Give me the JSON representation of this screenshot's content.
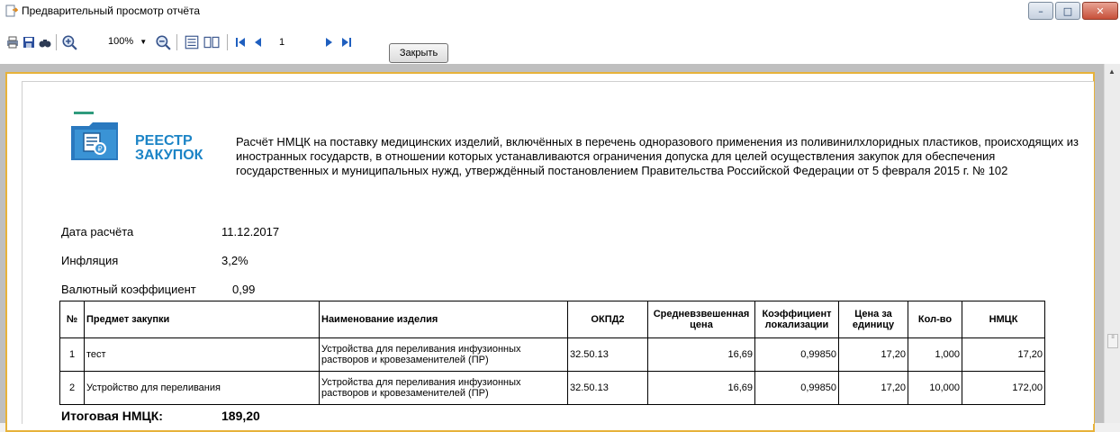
{
  "window": {
    "title": "Предварительный просмотр отчёта",
    "buttons": {
      "minimize": "–",
      "maximize": "□",
      "close": "✕"
    }
  },
  "toolbar": {
    "zoom": "100%",
    "page": "1",
    "close_label": "Закрыть",
    "icons": [
      "printer-icon",
      "save-icon",
      "find-icon",
      "zoom-in-icon",
      "zoom-out-icon",
      "single-page-icon",
      "multi-page-icon",
      "first-page-icon",
      "prev-page-icon",
      "next-page-icon",
      "last-page-icon"
    ]
  },
  "report": {
    "logo": {
      "line1": "РЕЕСТР",
      "line2": "ЗАКУПОК"
    },
    "description": "Расчёт НМЦК на поставку медицинских изделий, включённых в перечень одноразового применения из поливинилхлоридных пластиков, происходящих из иностранных государств, в отношении которых устанавливаются ограничения допуска для целей осуществления закупок для обеспечения государственных и муниципальных нужд, утверждённый постановлением Правительства Российской Федерации от 5 февраля 2015 г. № 102",
    "fields": [
      {
        "label": "Дата расчёта",
        "value": "11.12.2017"
      },
      {
        "label": "Инфляция",
        "value": "3,2%"
      },
      {
        "label": "Валютный коэффициент",
        "value": "0,99"
      }
    ],
    "table": {
      "headers": [
        "№",
        "Предмет закупки",
        "Наименование изделия",
        "ОКПД2",
        "Средневзвешенная цена",
        "Коэффициент локализации",
        "Цена за единицу",
        "Кол-во",
        "НМЦК"
      ],
      "rows": [
        [
          "1",
          "тест",
          "Устройства для переливания инфузионных растворов и кровезаменителей (ПР)",
          "32.50.13",
          "16,69",
          "0,99850",
          "17,20",
          "1,000",
          "17,20"
        ],
        [
          "2",
          "Устройство для переливания",
          "Устройства для переливания инфузионных растворов и кровезаменителей (ПР)",
          "32.50.13",
          "16,69",
          "0,99850",
          "17,20",
          "10,000",
          "172,00"
        ]
      ]
    },
    "total_label": "Итоговая НМЦК:",
    "total_value": "189,20"
  }
}
